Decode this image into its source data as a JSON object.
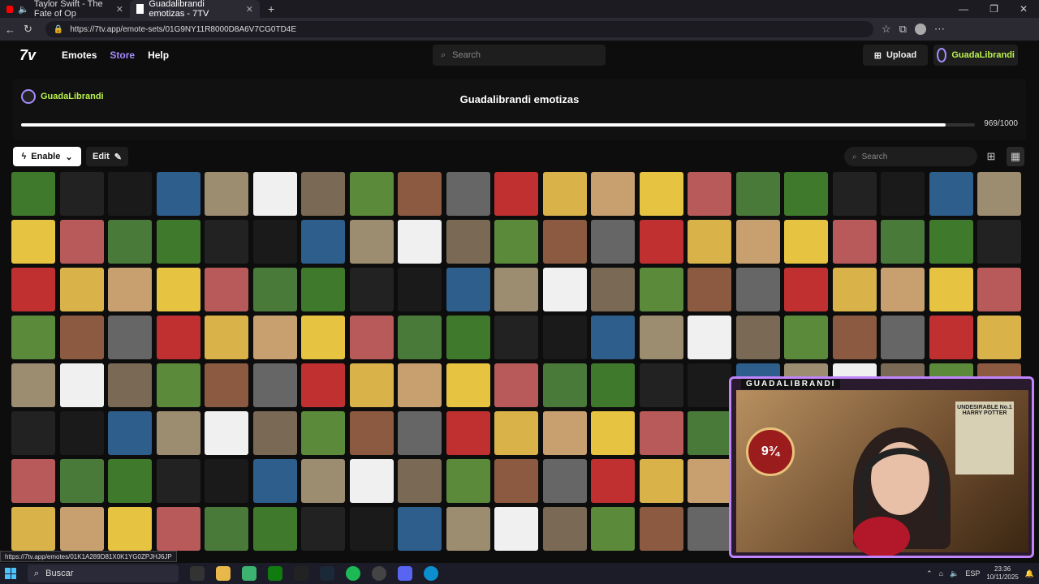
{
  "browser": {
    "tabs": [
      {
        "title": "Taylor Swift - The Fate of Op"
      },
      {
        "title": "Guadalibrandi emotizas - 7TV"
      }
    ],
    "url": "https://7tv.app/emote-sets/01G9NY11R8000D8A6V7CG0TD4E",
    "status_url": "https://7tv.app/emotes/01K1A289D81X0K1YG0ZPJHJ6JP"
  },
  "nav": {
    "logo": "7v",
    "emotes": "Emotes",
    "store": "Store",
    "help": "Help",
    "search_placeholder": "Search",
    "upload": "Upload",
    "username": "GuadaLibrandi"
  },
  "emote_set": {
    "owner": "GuadaLibrandi",
    "title": "Guadalibrandi emotizas",
    "count": "969/1000",
    "fill_fraction": 0.969,
    "enable_label": "Enable",
    "edit_label": "Edit",
    "search_placeholder": "Search"
  },
  "stream_overlay": {
    "label": "GUADALIBRANDI",
    "platform_sign": "9¾",
    "poster": "UNDESIRABLE No.1 HARRY POTTER"
  },
  "taskbar": {
    "search": "Buscar",
    "lang": "ESP",
    "time": "23:36",
    "date": "10/11/2025"
  },
  "emote_colors": [
    "#3f7a2c",
    "#d9b34a",
    "#7a6a55",
    "#222222",
    "#c8a070",
    "#5b8a3a",
    "#1a1a1a",
    "#e6c340",
    "#8c5a40",
    "#2d5e8c",
    "#b85a5a",
    "#666666",
    "#9c8c70",
    "#4a7a3a",
    "#c03030",
    "#f0f0f0"
  ]
}
